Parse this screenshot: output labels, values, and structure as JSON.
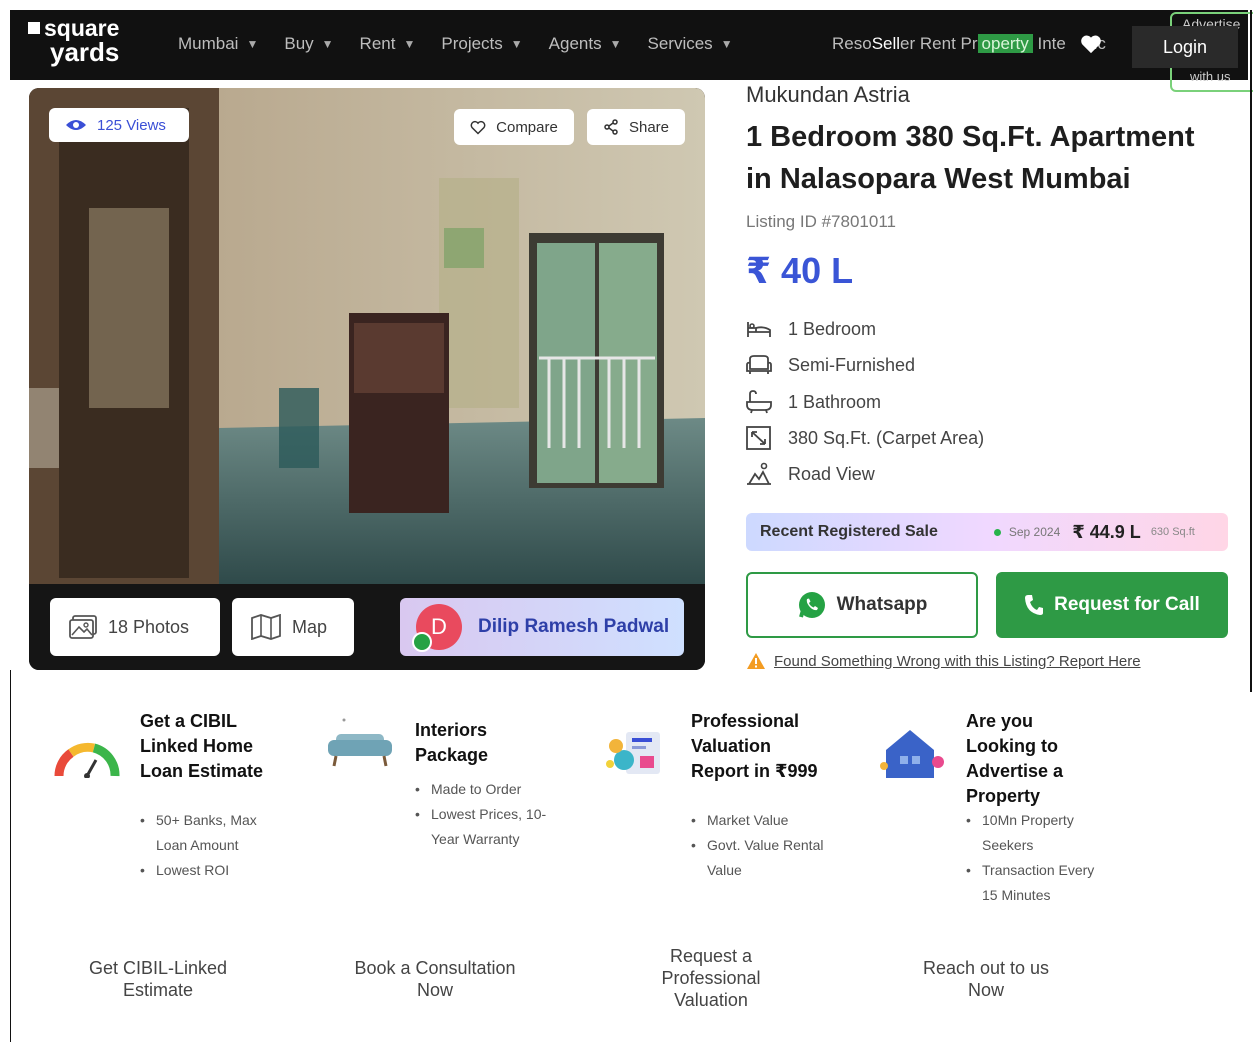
{
  "header": {
    "logo_line1": "square",
    "logo_line2": "yards",
    "nav": [
      {
        "label": "Mumbai"
      },
      {
        "label": "Buy"
      },
      {
        "label": "Rent"
      },
      {
        "label": "Projects"
      },
      {
        "label": "Agents"
      },
      {
        "label": "Services"
      }
    ],
    "nav_overflow_a": "Reso",
    "nav_overflow_sell": "Sell",
    "nav_overflow_b": "er Rent Pr",
    "nav_overflow_hl": "operty",
    "nav_overflow_c": " Inte",
    "nav_overflow_d": "nc",
    "login_label": "Login",
    "advertise_top": "Advertise",
    "advertise_bottom": "with us"
  },
  "gallery": {
    "views_label": "125 Views",
    "compare_label": "Compare",
    "share_label": "Share",
    "photos_label": "18 Photos",
    "map_label": "Map",
    "agent_initial": "D",
    "agent_name": "Dilip Ramesh Padwal"
  },
  "listing": {
    "builder": "Mukundan Astria",
    "title": "1 Bedroom 380 Sq.Ft. Apartment in Nalasopara West Mumbai",
    "listing_id": "Listing ID #7801011",
    "price": "₹ 40 L",
    "specs": [
      {
        "icon": "bed-icon",
        "label": "1 Bedroom"
      },
      {
        "icon": "sofa-icon",
        "label": "Semi-Furnished"
      },
      {
        "icon": "bathtub-icon",
        "label": "1 Bathroom"
      },
      {
        "icon": "area-icon",
        "label": "380 Sq.Ft. (Carpet Area)"
      },
      {
        "icon": "view-icon",
        "label": "Road View"
      }
    ],
    "recent_sale": {
      "label": "Recent Registered Sale",
      "date": "Sep 2024",
      "amount": "₹ 44.9 L",
      "area": "630 Sq.ft"
    },
    "whatsapp_label": "Whatsapp",
    "call_label": "Request for Call",
    "report_label": "Found Something Wrong with this Listing? Report Here"
  },
  "promos": [
    {
      "icon": "gauge-icon",
      "title": "Get a CIBIL Linked Home Loan Estimate",
      "bullets": [
        "50+ Banks, Max Loan Amount",
        "Lowest ROI"
      ],
      "cta": "Get CIBIL-Linked Estimate"
    },
    {
      "icon": "sofa-illustration-icon",
      "title": "Interiors Package",
      "bullets": [
        "Made to Order",
        "Lowest Prices, 10-Year Warranty"
      ],
      "cta": "Book a Consultation Now"
    },
    {
      "icon": "report-illustration-icon",
      "title": "Professional Valuation Report in ₹999",
      "bullets": [
        "Market Value",
        "Govt. Value Rental Value"
      ],
      "cta": "Request a Professional Valuation"
    },
    {
      "icon": "house-illustration-icon",
      "title": "Are you Looking to Advertise a Property",
      "bullets": [
        "10Mn Property Seekers",
        "Transaction Every 15 Minutes"
      ],
      "cta": "Reach out to us Now"
    }
  ],
  "colors": {
    "accent_blue": "#3a55d6",
    "brand_green": "#2e9a45",
    "header_bg": "#111111"
  }
}
